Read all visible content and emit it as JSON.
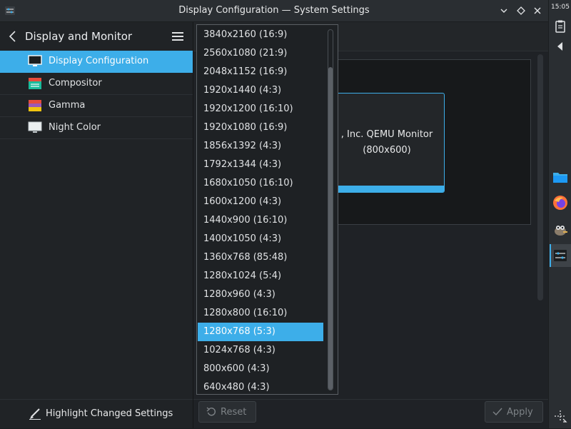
{
  "window": {
    "title": "Display Configuration — System Settings"
  },
  "sidebar": {
    "title": "Display and Monitor",
    "items": [
      {
        "label": "Display Configuration",
        "icon": "monitor-icon",
        "selected": true
      },
      {
        "label": "Compositor",
        "icon": "compositor-icon",
        "selected": false
      },
      {
        "label": "Gamma",
        "icon": "gamma-icon",
        "selected": false
      },
      {
        "label": "Night Color",
        "icon": "night-color-icon",
        "selected": false
      }
    ],
    "footer_label": "Highlight Changed Settings"
  },
  "main": {
    "monitor_name": ", Inc. QEMU Monitor",
    "monitor_resolution": "(800x600)",
    "reset_label": "Reset",
    "apply_label": "Apply"
  },
  "resolution_dropdown": {
    "options": [
      "3840x2160 (16:9)",
      "2560x1080 (21:9)",
      "2048x1152 (16:9)",
      "1920x1440 (4:3)",
      "1920x1200 (16:10)",
      "1920x1080 (16:9)",
      "1856x1392 (4:3)",
      "1792x1344 (4:3)",
      "1680x1050 (16:10)",
      "1600x1200 (4:3)",
      "1440x900 (16:10)",
      "1400x1050 (4:3)",
      "1360x768 (85:48)",
      "1280x1024 (5:4)",
      "1280x960 (4:3)",
      "1280x800 (16:10)",
      "1280x768 (5:3)",
      "1024x768 (4:3)",
      "800x600 (4:3)",
      "640x480 (4:3)"
    ],
    "selected": "1280x768 (5:3)"
  },
  "panel": {
    "clock": "15:05",
    "icons": [
      "clipboard-icon",
      "expand-arrow-icon",
      "file-manager-icon",
      "firefox-icon",
      "gimp-icon",
      "system-settings-icon",
      "move-icon"
    ]
  },
  "colors": {
    "accent": "#3daee9",
    "background": "#202326",
    "text": "#e0e2e4"
  }
}
